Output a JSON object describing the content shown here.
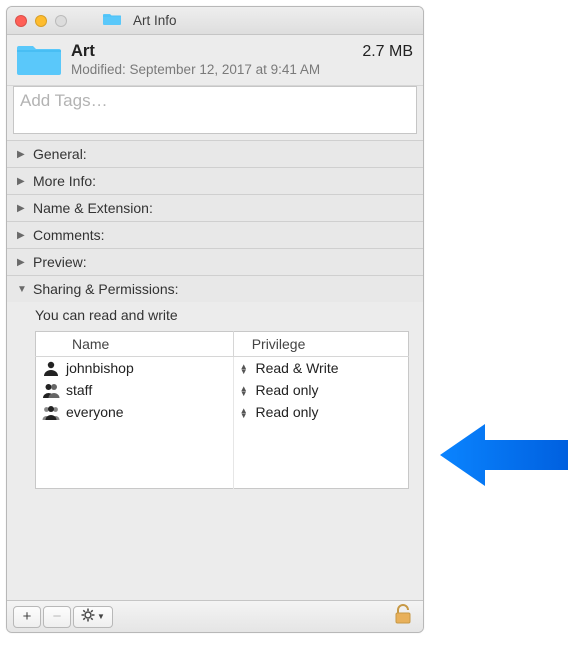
{
  "window": {
    "title": "Art Info"
  },
  "header": {
    "name": "Art",
    "size": "2.7 MB",
    "modified": "Modified: September 12, 2017 at 9:41 AM"
  },
  "tags": {
    "placeholder": "Add Tags…"
  },
  "sections": [
    {
      "label": "General:",
      "expanded": false
    },
    {
      "label": "More Info:",
      "expanded": false
    },
    {
      "label": "Name & Extension:",
      "expanded": false
    },
    {
      "label": "Comments:",
      "expanded": false
    },
    {
      "label": "Preview:",
      "expanded": false
    },
    {
      "label": "Sharing & Permissions:",
      "expanded": true
    }
  ],
  "permissions": {
    "intro": "You can read and write",
    "columns": {
      "name": "Name",
      "privilege": "Privilege"
    },
    "rows": [
      {
        "icon": "single",
        "name": "johnbishop",
        "privilege": "Read & Write"
      },
      {
        "icon": "double",
        "name": "staff",
        "privilege": "Read only"
      },
      {
        "icon": "group",
        "name": "everyone",
        "privilege": "Read only"
      }
    ]
  },
  "footer": {
    "add": "+",
    "remove": "−",
    "gear": "✱",
    "locked": false
  }
}
